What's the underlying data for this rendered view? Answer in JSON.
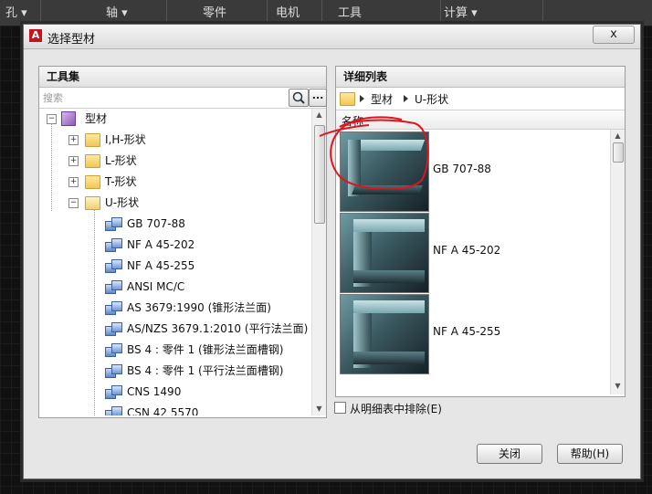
{
  "background": {
    "ribbon_tabs": [
      "孔 ▾",
      "轴 ▾",
      "零件",
      "电机",
      "工具",
      "计算 ▾"
    ]
  },
  "dialog": {
    "title": "选择型材",
    "close_label": "x",
    "help_label": "帮助(H)",
    "close_button_label": "关闭"
  },
  "toolset": {
    "header": "工具集",
    "search_placeholder": "搜索",
    "more_label": "...",
    "tree": {
      "root": "型材",
      "folders": [
        "I,H-形状",
        "L-形状",
        "T-形状",
        "U-形状"
      ],
      "u_shape_items": [
        "GB 707-88",
        "NF A 45-202",
        "NF A 45-255",
        "ANSI MC/C",
        "AS 3679:1990 (锥形法兰面)",
        "AS/NZS 3679.1:2010 (平行法兰面)",
        "BS 4 : 零件 1  (锥形法兰面槽钢)",
        "BS 4 : 零件 1  (平行法兰面槽钢)",
        "CNS 1490",
        "CSN 42 5570"
      ]
    }
  },
  "details": {
    "header": "详细列表",
    "breadcrumb": [
      "型材",
      "U-形状"
    ],
    "column_name": "名称",
    "items": [
      "GB 707-88",
      "NF A 45-202",
      "NF A 45-255"
    ],
    "exclude_checkbox_label": "从明细表中排除(E)",
    "exclude_checked": false
  },
  "colors": {
    "annotation": "#e0141c",
    "dialog_bg": "#e6e6e6"
  }
}
